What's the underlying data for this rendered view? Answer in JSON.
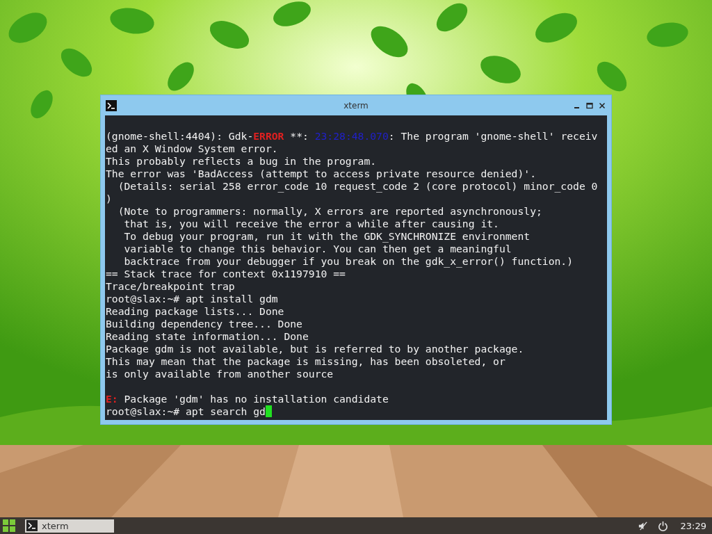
{
  "window": {
    "title": "xterm",
    "cursor": true,
    "lines": [
      {
        "gap_before": true,
        "segments": [
          {
            "kind": "plain",
            "text": "(gnome-shell:4404): Gdk-"
          },
          {
            "kind": "error",
            "text": "ERROR"
          },
          {
            "kind": "plain",
            "text": " **: "
          },
          {
            "kind": "time",
            "text": "23:28:48.070"
          },
          {
            "kind": "plain",
            "text": ": The program 'gnome-shell' receiv"
          }
        ]
      },
      {
        "segments": [
          {
            "kind": "plain",
            "text": "ed an X Window System error."
          }
        ]
      },
      {
        "segments": [
          {
            "kind": "plain",
            "text": "This probably reflects a bug in the program."
          }
        ]
      },
      {
        "segments": [
          {
            "kind": "plain",
            "text": "The error was 'BadAccess (attempt to access private resource denied)'."
          }
        ]
      },
      {
        "segments": [
          {
            "kind": "plain",
            "text": "  (Details: serial 258 error_code 10 request_code 2 (core protocol) minor_code 0"
          }
        ]
      },
      {
        "segments": [
          {
            "kind": "plain",
            "text": ")"
          }
        ]
      },
      {
        "segments": [
          {
            "kind": "plain",
            "text": "  (Note to programmers: normally, X errors are reported asynchronously;"
          }
        ]
      },
      {
        "segments": [
          {
            "kind": "plain",
            "text": "   that is, you will receive the error a while after causing it."
          }
        ]
      },
      {
        "segments": [
          {
            "kind": "plain",
            "text": "   To debug your program, run it with the GDK_SYNCHRONIZE environment"
          }
        ]
      },
      {
        "segments": [
          {
            "kind": "plain",
            "text": "   variable to change this behavior. You can then get a meaningful"
          }
        ]
      },
      {
        "segments": [
          {
            "kind": "plain",
            "text": "   backtrace from your debugger if you break on the gdk_x_error() function.)"
          }
        ]
      },
      {
        "segments": [
          {
            "kind": "plain",
            "text": "== Stack trace for context 0x1197910 =="
          }
        ]
      },
      {
        "segments": [
          {
            "kind": "plain",
            "text": "Trace/breakpoint trap"
          }
        ]
      },
      {
        "segments": [
          {
            "kind": "plain",
            "text": "root@slax:~# apt install gdm"
          }
        ]
      },
      {
        "segments": [
          {
            "kind": "plain",
            "text": "Reading package lists... Done"
          }
        ]
      },
      {
        "segments": [
          {
            "kind": "plain",
            "text": "Building dependency tree... Done"
          }
        ]
      },
      {
        "segments": [
          {
            "kind": "plain",
            "text": "Reading state information... Done"
          }
        ]
      },
      {
        "segments": [
          {
            "kind": "plain",
            "text": "Package gdm is not available, but is referred to by another package."
          }
        ]
      },
      {
        "segments": [
          {
            "kind": "plain",
            "text": "This may mean that the package is missing, has been obsoleted, or"
          }
        ]
      },
      {
        "segments": [
          {
            "kind": "plain",
            "text": "is only available from another source"
          }
        ]
      },
      {
        "gap_before": true,
        "segments": [
          {
            "kind": "error",
            "text": "E:"
          },
          {
            "kind": "plain",
            "text": " Package 'gdm' has no installation candidate"
          }
        ]
      },
      {
        "segments": [
          {
            "kind": "plain",
            "text": "root@slax:~# apt search gd"
          }
        ]
      }
    ]
  },
  "taskbar": {
    "tasks": [
      {
        "label": "xterm",
        "selected": true
      }
    ],
    "clock": "23:29"
  }
}
